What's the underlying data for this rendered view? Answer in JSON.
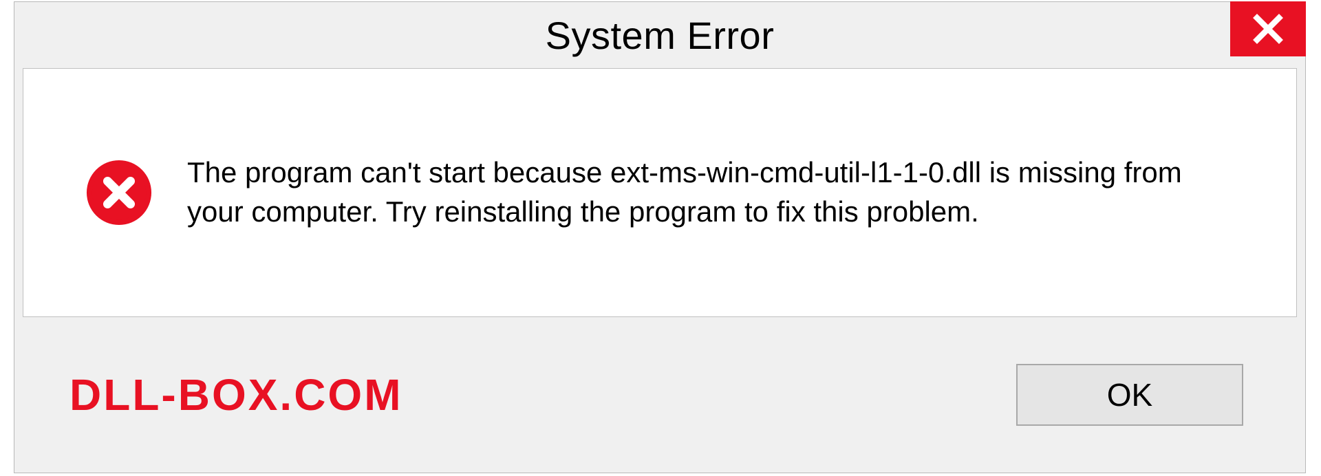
{
  "title": "System Error",
  "message": "The program can't start because ext-ms-win-cmd-util-l1-1-0.dll is missing from your computer. Try reinstalling the program to fix this problem.",
  "ok_label": "OK",
  "watermark": "DLL-BOX.COM",
  "colors": {
    "accent_red": "#e81123",
    "dialog_bg": "#f0f0f0",
    "content_bg": "#ffffff",
    "button_bg": "#e5e5e5"
  },
  "icons": {
    "close": "close-icon",
    "error": "error-circle-x-icon"
  }
}
